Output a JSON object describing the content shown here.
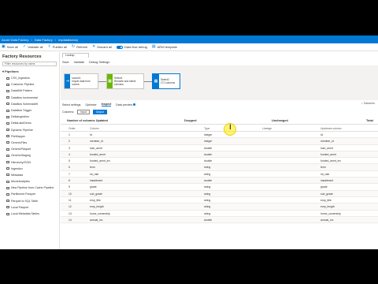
{
  "topbar": {
    "brand": "Azure Data Factory",
    "breadcrumb": [
      "Data Factory",
      "mydatafactory"
    ]
  },
  "toolbar": {
    "items": [
      "Save all",
      "Validate all",
      "Publish all",
      "Refresh",
      "Discard all"
    ],
    "debug_label": "Data flow debug",
    "arm_label": "ARM template"
  },
  "sidebar": {
    "title": "Factory Resources",
    "search_placeholder": "Filter resources by name",
    "group": "Pipelines",
    "items": [
      "CSV_Ingestion",
      "Customer Pipeline",
      "DataDrift Pattern",
      "Dataflow Incremental",
      "Dataflow Schemadrift",
      "Dataflow Trigger",
      "DeltaIngestion",
      "DeltaLakeDemo",
      "Dynamic Pipeline",
      "FileMapper",
      "GenericFiles",
      "GenericParquet",
      "GenericStaging",
      "HierarchyJSON",
      "Ingestion",
      "Metadata",
      "MovieAnalytics",
      "New Pipeline from Cache Pipeline",
      "Partitioned Parquet",
      "Parquet to SQL Table",
      "Local Parquet",
      "Local Metadata Tables"
    ]
  },
  "editor": {
    "tab_label": "Lookup",
    "toolbar": [
      "Save",
      "Validate",
      "Debug Settings"
    ],
    "nodes": [
      {
        "title": "source1",
        "desc": "Import data from source"
      },
      {
        "title": "Select1",
        "desc": "Rename and select columns"
      },
      {
        "title": "Select2",
        "desc": "171 columns"
      }
    ],
    "panel_tabs": [
      "Select settings",
      "Optimize",
      "Inspect",
      "Data preview"
    ],
    "active_panel_tab": "Inspect",
    "dataset_label": "Datasets",
    "filter_label": "Columns:",
    "filter_buttons": [
      "Input",
      "Output"
    ],
    "column_groups": [
      "Number of columns  Updated",
      "Dropped",
      "Unchanged",
      "Total"
    ],
    "grid_headers": [
      "Order",
      "Column",
      "Type",
      "Lineage",
      "Upstream column"
    ],
    "rows": [
      {
        "order": "1",
        "column": "Id",
        "type": "integer",
        "upstream": "Id"
      },
      {
        "order": "2",
        "column": "member_id",
        "type": "integer",
        "upstream": "member_id"
      },
      {
        "order": "3",
        "column": "loan_amnt",
        "type": "double",
        "upstream": "loan_amnt"
      },
      {
        "order": "4",
        "column": "funded_amnt",
        "type": "double",
        "upstream": "funded_amnt"
      },
      {
        "order": "5",
        "column": "funded_amnt_inv",
        "type": "double",
        "upstream": "funded_amnt_inv"
      },
      {
        "order": "6",
        "column": "term",
        "type": "string",
        "upstream": "term"
      },
      {
        "order": "7",
        "column": "int_rate",
        "type": "string",
        "upstream": "int_rate"
      },
      {
        "order": "8",
        "column": "installment",
        "type": "double",
        "upstream": "installment"
      },
      {
        "order": "9",
        "column": "grade",
        "type": "string",
        "upstream": "grade"
      },
      {
        "order": "10",
        "column": "sub_grade",
        "type": "string",
        "upstream": "sub_grade"
      },
      {
        "order": "11",
        "column": "emp_title",
        "type": "string",
        "upstream": "emp_title"
      },
      {
        "order": "12",
        "column": "emp_length",
        "type": "string",
        "upstream": "emp_length"
      },
      {
        "order": "13",
        "column": "home_ownership",
        "type": "string",
        "upstream": "home_ownership"
      },
      {
        "order": "14",
        "column": "annual_inc",
        "type": "double",
        "upstream": "annual_inc"
      }
    ]
  },
  "colors": {
    "accent": "#0078d4",
    "node1": "#0078d4",
    "node2": "#6bb700",
    "node3": "#0078d4"
  }
}
